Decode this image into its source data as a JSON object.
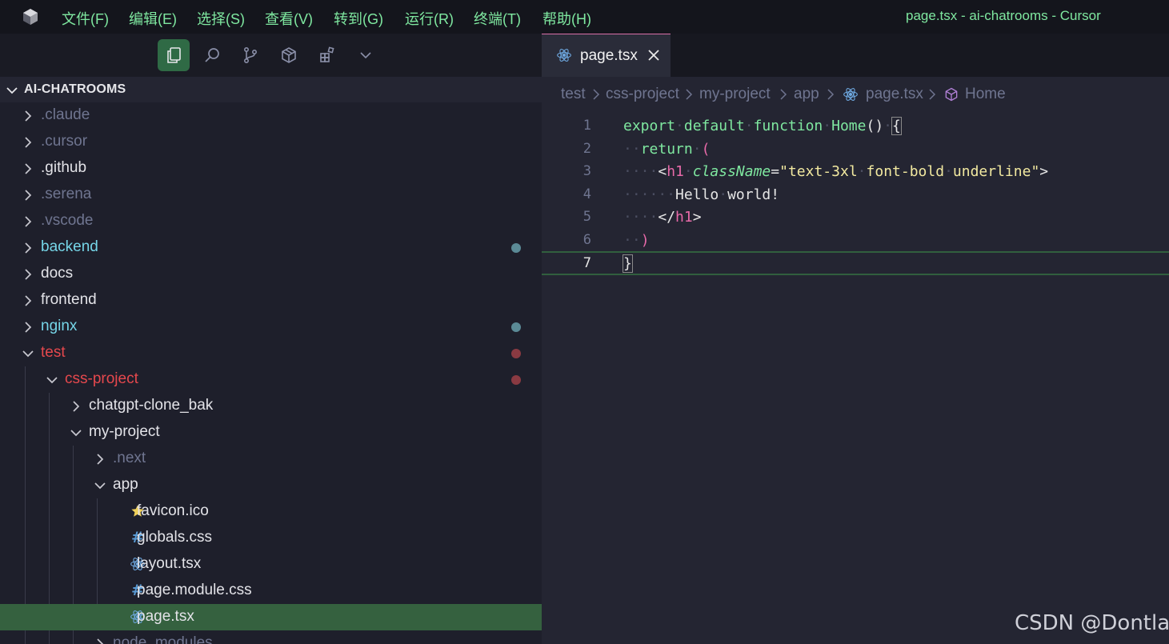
{
  "titlebar": {
    "menus": [
      "文件(F)",
      "编辑(E)",
      "选择(S)",
      "查看(V)",
      "转到(G)",
      "运行(R)",
      "终端(T)",
      "帮助(H)"
    ],
    "window_title": "page.tsx - ai-chatrooms - Cursor"
  },
  "activity": {
    "icons": [
      "files-icon",
      "search-icon",
      "source-control-icon",
      "extensions-box-icon",
      "extensions-grid-icon",
      "chevron-down-icon"
    ],
    "active": "files-icon"
  },
  "explorer": {
    "root": "AI-CHATROOMS",
    "items": [
      {
        "label": ".claude",
        "type": "folder",
        "state": "collapsed",
        "depth": 0,
        "color": "dim"
      },
      {
        "label": ".cursor",
        "type": "folder",
        "state": "collapsed",
        "depth": 0,
        "color": "dim"
      },
      {
        "label": ".github",
        "type": "folder",
        "state": "collapsed",
        "depth": 0,
        "color": "normal"
      },
      {
        "label": ".serena",
        "type": "folder",
        "state": "collapsed",
        "depth": 0,
        "color": "dim"
      },
      {
        "label": ".vscode",
        "type": "folder",
        "state": "collapsed",
        "depth": 0,
        "color": "dim"
      },
      {
        "label": "backend",
        "type": "folder",
        "state": "collapsed",
        "depth": 0,
        "color": "cyan",
        "dot": "#5b8a96"
      },
      {
        "label": "docs",
        "type": "folder",
        "state": "collapsed",
        "depth": 0,
        "color": "normal"
      },
      {
        "label": "frontend",
        "type": "folder",
        "state": "collapsed",
        "depth": 0,
        "color": "normal"
      },
      {
        "label": "nginx",
        "type": "folder",
        "state": "collapsed",
        "depth": 0,
        "color": "cyan",
        "dot": "#5b8a96"
      },
      {
        "label": "test",
        "type": "folder",
        "state": "expanded",
        "depth": 0,
        "color": "red",
        "dot": "#8a3a42"
      },
      {
        "label": "css-project",
        "type": "folder",
        "state": "expanded",
        "depth": 1,
        "color": "red",
        "dot": "#8a3a42"
      },
      {
        "label": "chatgpt-clone_bak",
        "type": "folder",
        "state": "collapsed",
        "depth": 2,
        "color": "normal"
      },
      {
        "label": "my-project",
        "type": "folder",
        "state": "expanded",
        "depth": 2,
        "color": "normal"
      },
      {
        "label": ".next",
        "type": "folder",
        "state": "collapsed",
        "depth": 3,
        "color": "dim"
      },
      {
        "label": "app",
        "type": "folder",
        "state": "expanded",
        "depth": 3,
        "color": "normal"
      },
      {
        "label": "favicon.ico",
        "type": "file",
        "icon": "star-icon",
        "depth": 4,
        "color": "normal"
      },
      {
        "label": "globals.css",
        "type": "file",
        "icon": "hash-icon",
        "depth": 4,
        "color": "normal"
      },
      {
        "label": "layout.tsx",
        "type": "file",
        "icon": "react-icon",
        "depth": 4,
        "color": "normal"
      },
      {
        "label": "page.module.css",
        "type": "file",
        "icon": "hash-icon",
        "depth": 4,
        "color": "normal"
      },
      {
        "label": "page.tsx",
        "type": "file",
        "icon": "react-icon",
        "depth": 4,
        "color": "normal",
        "selected": true
      },
      {
        "label": "node_modules",
        "type": "folder",
        "state": "collapsed",
        "depth": 3,
        "color": "dim"
      }
    ]
  },
  "tab": {
    "label": "page.tsx"
  },
  "breadcrumb": {
    "items": [
      "test",
      "css-project",
      "my-project",
      "app",
      "page.tsx",
      "Home"
    ]
  },
  "editor": {
    "line_numbers": [
      "1",
      "2",
      "3",
      "4",
      "5",
      "6",
      "7"
    ],
    "current_line": 7
  },
  "colors": {
    "accent_green": "#7fe8a0",
    "pink": "#e86aa9",
    "selection": "#35613f"
  },
  "watermark": "CSDN @Dontla"
}
